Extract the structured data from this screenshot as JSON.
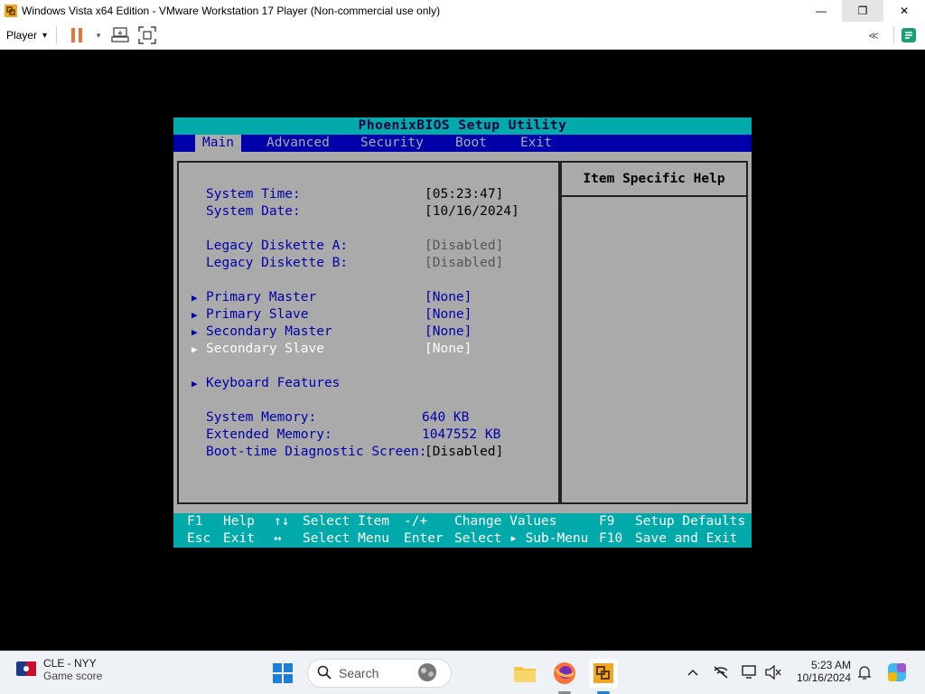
{
  "window": {
    "title": "Windows Vista x64 Edition - VMware Workstation 17 Player (Non-commercial use only)",
    "minimize_glyph": "—",
    "maximize_glyph": "❐",
    "close_glyph": "✕"
  },
  "toolbar": {
    "player_label": "Player",
    "player_caret": "▾",
    "icons": [
      "pause-icon",
      "send-keys-icon",
      "fullscreen-icon",
      "collapse-icon",
      "notes-icon"
    ],
    "collapse_glyph": "≪"
  },
  "bios": {
    "header": "PhoenixBIOS Setup Utility",
    "menu": [
      "Main",
      "Advanced",
      "Security",
      "Boot",
      "Exit"
    ],
    "selected_menu": "Main",
    "help_title": "Item Specific Help",
    "rows": [
      {
        "label": "System Time:",
        "value": "[05:23:47]"
      },
      {
        "label": "System Date:",
        "value": "[10/16/2024]"
      },
      {
        "label": "Legacy Diskette A:",
        "value": "[Disabled]"
      },
      {
        "label": "Legacy Diskette B:",
        "value": "[Disabled]"
      },
      {
        "label": "Primary Master",
        "value": "[None]"
      },
      {
        "label": "Primary Slave",
        "value": "[None]"
      },
      {
        "label": "Secondary Master",
        "value": "[None]"
      },
      {
        "label": "Secondary Slave",
        "value": "[None]"
      },
      {
        "label": "Keyboard Features",
        "value": ""
      },
      {
        "label": "System Memory:",
        "value": "640 KB"
      },
      {
        "label": "Extended Memory:",
        "value": "1047552 KB"
      },
      {
        "label": "Boot-time Diagnostic Screen:",
        "value": "[Disabled]"
      }
    ],
    "footer": {
      "line1": {
        "k1": "F1",
        "d1": "Help",
        "k2": "↑↓",
        "d2": "Select Item",
        "k3": "-/+",
        "d3": "Change Values",
        "k4": "F9",
        "d4": "Setup Defaults"
      },
      "line2": {
        "k1": "Esc",
        "d1": "Exit",
        "k2": "↔",
        "d2": "Select Menu",
        "k3": "Enter",
        "d3": "Select ▸ Sub-Menu",
        "k4": "F10",
        "d4": "Save and Exit"
      }
    }
  },
  "taskbar": {
    "weather_title": "CLE - NYY",
    "weather_sub": "Game score",
    "search_placeholder": "Search",
    "time": "5:23 AM",
    "date": "10/16/2024",
    "apps": [
      "widgets-app-icon",
      "file-explorer-icon",
      "firefox-icon",
      "vmware-icon"
    ],
    "tray": [
      "chevron-up-icon",
      "network-off-icon",
      "display-icon",
      "volume-muted-icon",
      "bell-icon",
      "copilot-icon"
    ]
  },
  "colors": {
    "bios_cyan": "#00aaaa",
    "bios_blue": "#0000aa",
    "bios_gray": "#aaaaaa"
  }
}
